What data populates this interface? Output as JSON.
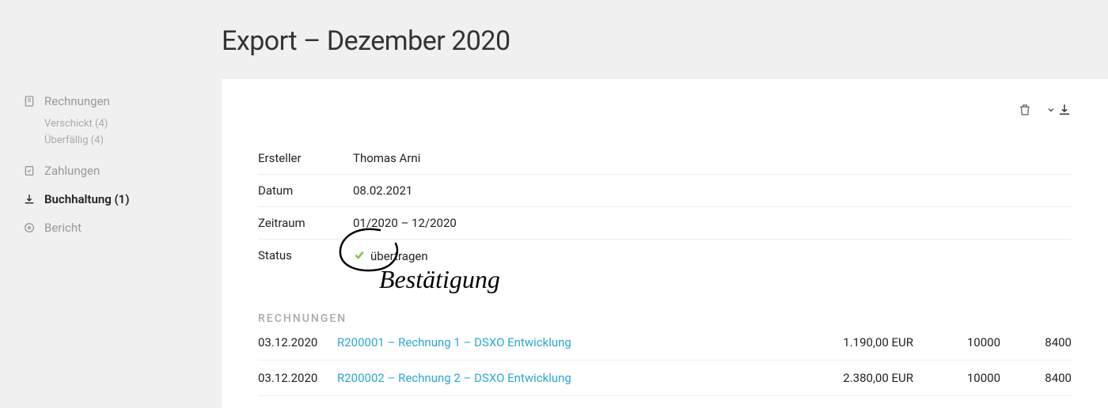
{
  "page": {
    "title": "Export – Dezember 2020"
  },
  "sidebar": {
    "items": [
      {
        "label": "Rechnungen",
        "icon": "document-icon"
      },
      {
        "label": "Zahlungen",
        "icon": "checklist-icon"
      },
      {
        "label": "Buchhaltung (1)",
        "icon": "download-icon"
      },
      {
        "label": "Bericht",
        "icon": "target-icon"
      }
    ],
    "subs": [
      {
        "label": "Verschickt (4)"
      },
      {
        "label": "Überfällig (4)"
      }
    ]
  },
  "meta": {
    "creator_label": "Ersteller",
    "creator_value": "Thomas Arni",
    "date_label": "Datum",
    "date_value": "08.02.2021",
    "period_label": "Zeitraum",
    "period_value": "01/2020 – 12/2020",
    "status_label": "Status",
    "status_value": "übertragen"
  },
  "section": {
    "invoices_heading": "RECHNUNGEN"
  },
  "invoices": [
    {
      "date": "03.12.2020",
      "link": "R200001 – Rechnung 1 – DSXO Entwicklung",
      "amount": "1.190,00 EUR",
      "acc1": "10000",
      "acc2": "8400"
    },
    {
      "date": "03.12.2020",
      "link": "R200002 – Rechnung 2 – DSXO Entwicklung",
      "amount": "2.380,00 EUR",
      "acc1": "10000",
      "acc2": "8400"
    }
  ],
  "annotation": {
    "text": "Bestätigung"
  }
}
